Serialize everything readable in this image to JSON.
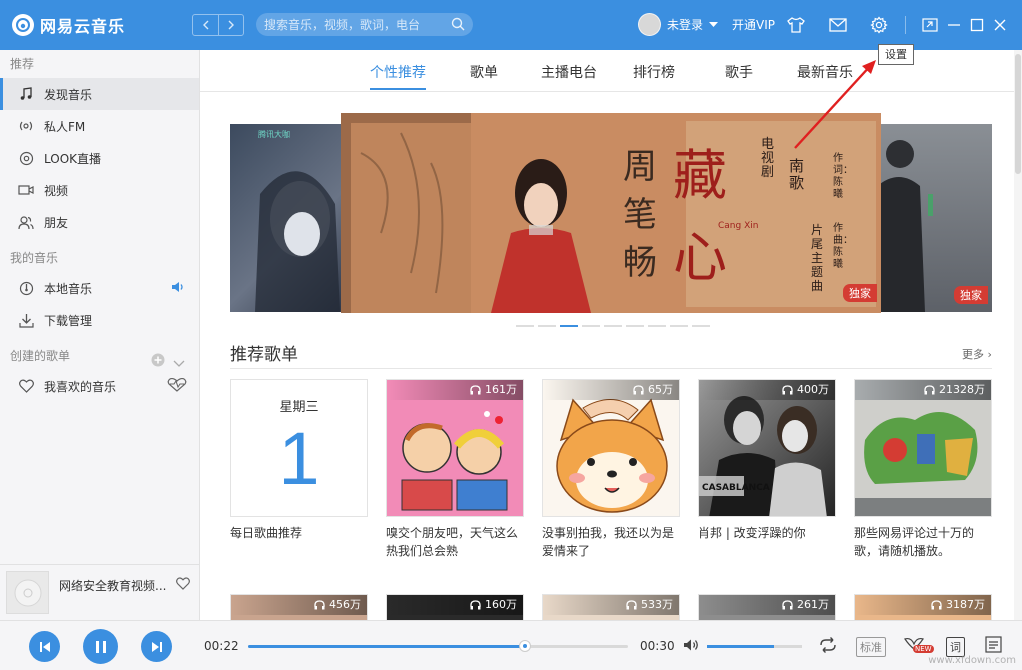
{
  "app": {
    "title": "网易云音乐",
    "brand_color": "#3B8FE0"
  },
  "search": {
    "placeholder": "搜索音乐，视频，歌词，电台"
  },
  "user": {
    "name": "未登录",
    "vip": "开通VIP"
  },
  "tooltip": {
    "text": "设置"
  },
  "sidebar": {
    "sections": [
      {
        "title": "推荐",
        "items": [
          {
            "label": "发现音乐",
            "icon": "music-note-icon",
            "active": true
          },
          {
            "label": "私人FM",
            "icon": "radio-icon"
          },
          {
            "label": "LOOK直播",
            "icon": "live-icon"
          },
          {
            "label": "视频",
            "icon": "video-icon"
          },
          {
            "label": "朋友",
            "icon": "friends-icon"
          }
        ]
      },
      {
        "title": "我的音乐",
        "items": [
          {
            "label": "本地音乐",
            "icon": "local-music-icon"
          },
          {
            "label": "下载管理",
            "icon": "download-icon"
          }
        ]
      },
      {
        "title": "创建的歌单",
        "items": [
          {
            "label": "我喜欢的音乐",
            "icon": "heart-icon"
          }
        ]
      }
    ],
    "now_playing": {
      "title": "网络安全教育视频..."
    }
  },
  "tabs": [
    "个性推荐",
    "歌单",
    "主播电台",
    "排行榜",
    "歌手",
    "最新音乐"
  ],
  "banner": {
    "singer": "周笔畅",
    "song": "藏心",
    "song_pinyin": "Cang Xin",
    "drama": "电视剧",
    "drama_name": "南歌",
    "theme_note": "片尾主题曲",
    "lyric_credit": "作词：陈曦",
    "music_credit": "作曲：陈曦",
    "badge": "独家",
    "side_logo": "腾讯大咖",
    "total_slides": 9,
    "current_slide": 3
  },
  "section": {
    "title": "推荐歌单",
    "more": "更多"
  },
  "daily": {
    "day": "星期三",
    "date": "1",
    "name": "每日歌曲推荐"
  },
  "playlists": [
    {
      "count": "161万",
      "name": "嗅交个朋友吧，天气这么热我们总会熟"
    },
    {
      "count": "65万",
      "name": "没事别拍我，我还以为是爱情来了"
    },
    {
      "count": "400万",
      "name": "肖邦 | 改变浮躁的你"
    },
    {
      "count": "21328万",
      "name": "那些网易评论过十万的歌，请随机播放。"
    }
  ],
  "playlists_row2": [
    "456万",
    "160万",
    "533万",
    "261万",
    "3187万"
  ],
  "player": {
    "current_time": "00:22",
    "total_time": "00:30",
    "progress": 0.73,
    "volume": 0.7,
    "quality": "标准",
    "lyrics": "词",
    "new_badge": "NEW"
  },
  "watermark": "www.xfdown.com"
}
